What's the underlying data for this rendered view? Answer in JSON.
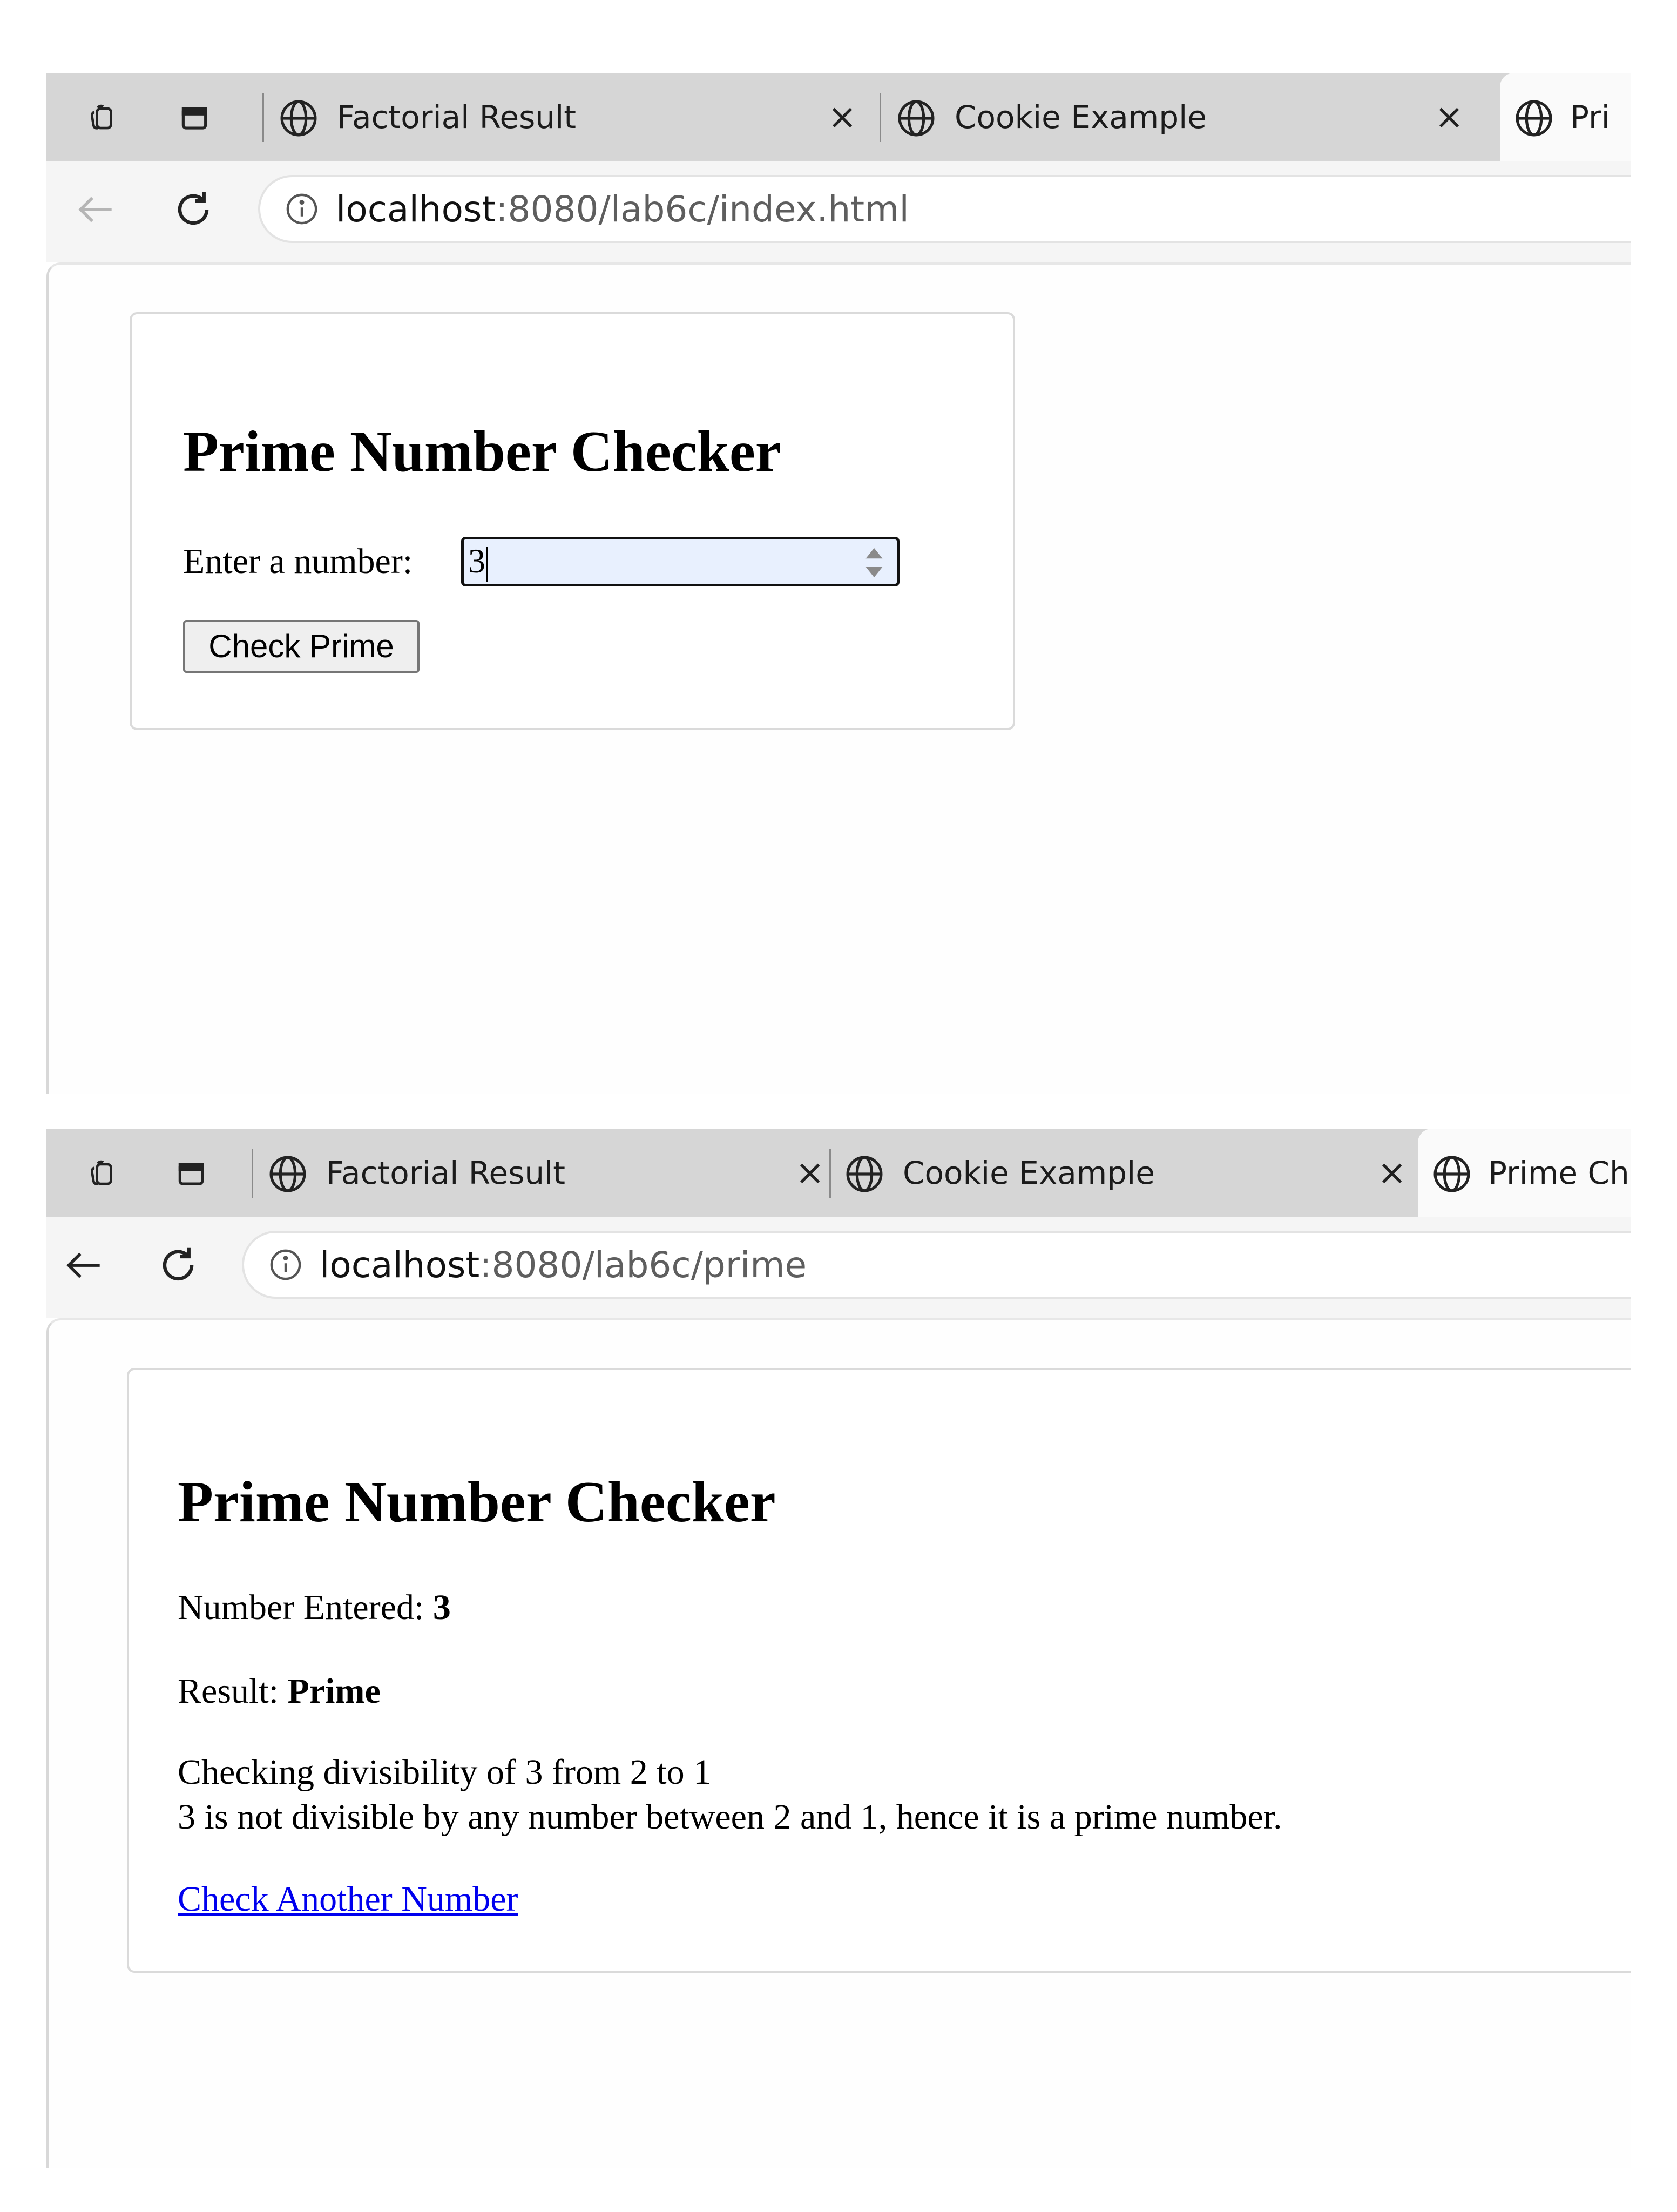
{
  "screen1": {
    "tabs": [
      {
        "title": "Factorial Result",
        "close": "×"
      },
      {
        "title": "Cookie Example",
        "close": "×"
      },
      {
        "title": "Pri"
      }
    ],
    "url": {
      "host": "localhost",
      "path": ":8080/lab6c/index.html"
    },
    "heading": "Prime Number Checker",
    "input_label": "Enter a number:",
    "input_value": "3",
    "button_label": "Check Prime"
  },
  "screen2": {
    "tabs": [
      {
        "title": "Factorial Result",
        "close": "×"
      },
      {
        "title": "Cookie Example",
        "close": "×"
      },
      {
        "title": "Prime Che"
      }
    ],
    "url": {
      "host": "localhost",
      "path": ":8080/lab6c/prime"
    },
    "heading": "Prime Number Checker",
    "number_label": "Number Entered:",
    "number_value": "3",
    "result_label": "Result:",
    "result_value": "Prime",
    "detail_line1": "Checking divisibility of 3 from 2 to 1",
    "detail_line2": "3 is not divisible by any number between 2 and 1, hence it is a prime number.",
    "link_label": "Check Another Number"
  },
  "icons": {
    "workspaces": "workspaces-icon",
    "tab_actions": "tab-actions-icon",
    "globe": "globe-icon",
    "back": "back-arrow-icon",
    "refresh": "refresh-icon",
    "info": "info-icon",
    "spinner": "spinner-arrows-icon"
  },
  "colors": {
    "tabbar_bg": "#d6d6d6",
    "active_tab_bg": "#fafafa",
    "link": "#0000ee",
    "input_bg": "#e8f0fe",
    "button_bg": "#efefef"
  }
}
